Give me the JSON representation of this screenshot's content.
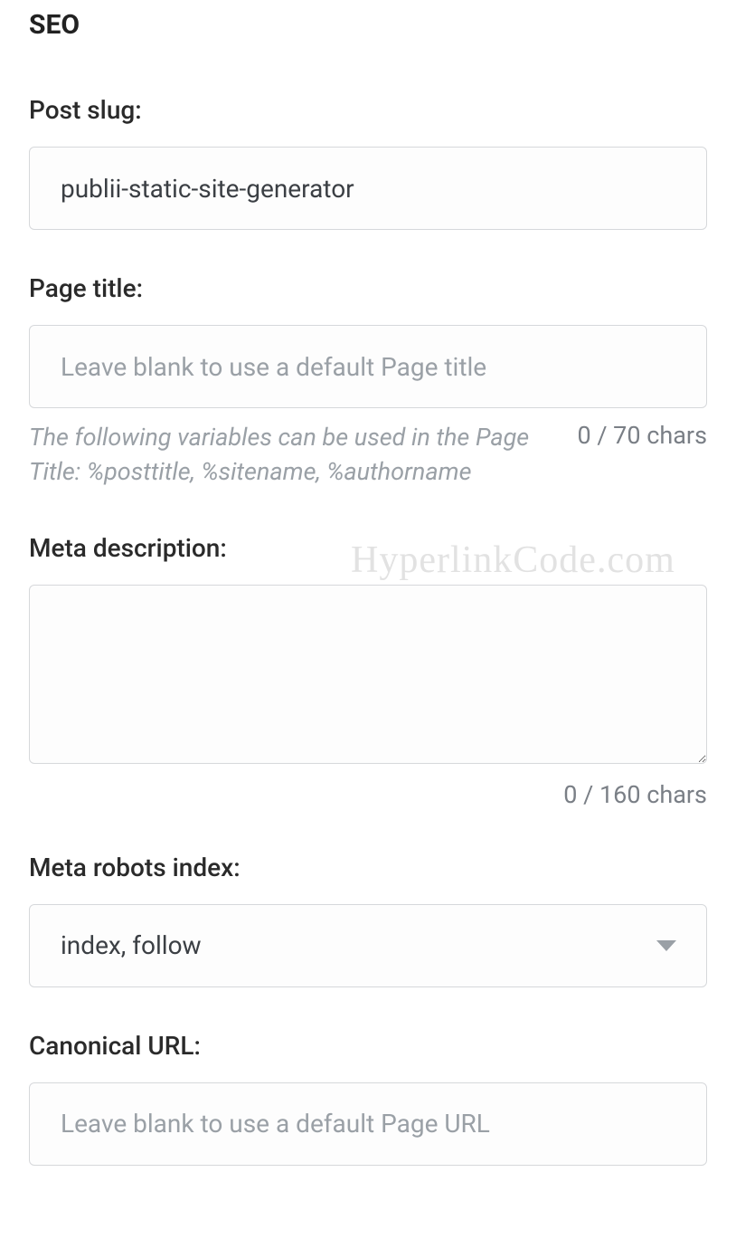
{
  "section_heading": "SEO",
  "post_slug": {
    "label": "Post slug:",
    "value": "publii-static-site-generator"
  },
  "page_title": {
    "label": "Page title:",
    "value": "",
    "placeholder": "Leave blank to use a default Page title",
    "help": "The following variables can be used in the Page Title: %posttitle, %sitename, %authorname",
    "count": "0 / 70 chars"
  },
  "meta_description": {
    "label": "Meta description:",
    "value": "",
    "count": "0 / 160 chars"
  },
  "meta_robots": {
    "label": "Meta robots index:",
    "selected": "index, follow"
  },
  "canonical_url": {
    "label": "Canonical URL:",
    "value": "",
    "placeholder": "Leave blank to use a default Page URL"
  },
  "watermark": "HyperlinkCode.com"
}
